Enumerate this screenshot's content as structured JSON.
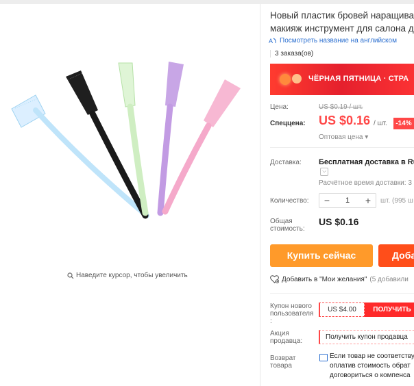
{
  "gallery": {
    "zoom_hint": "Наведите курсор, чтобы увеличить"
  },
  "product": {
    "title_line1": "Новый пластик бровей наращивание",
    "title_line2": "макияж инструмент для салона дом",
    "translate_link": "Посмотреть название на английском",
    "orders": "3 заказа(ов)"
  },
  "banner": {
    "text": "ЧЁРНАЯ ПЯТНИЦА · СТРА"
  },
  "price": {
    "label": "Цена:",
    "old": "US $0.19 / шт.",
    "special_label": "Спеццена:",
    "current": "US $0.16",
    "unit": "/ шт.",
    "discount": "-14%",
    "wholesale": "Оптовая цена ▾"
  },
  "shipping": {
    "label": "Доставка:",
    "method": "Бесплатная доставка в Russ",
    "dropdown_icon": "chevron-down-icon",
    "time": "Расчётное время доставки: 3"
  },
  "quantity": {
    "label": "Количество:",
    "minus": "−",
    "value": "1",
    "plus": "+",
    "stock": "шт. (995 ш"
  },
  "total": {
    "label_line1": "Общая",
    "label_line2": "стоимость:",
    "value": "US $0.16"
  },
  "actions": {
    "buy_now": "Купить сейчас",
    "add_to_cart": "Доба",
    "wishlist": "Добавить в \"Мои желания\"",
    "wishlist_count": "(5 добавили"
  },
  "coupons": {
    "new_user_label_1": "Купон нового",
    "new_user_label_2": "пользователя",
    "new_user_label_3": ":",
    "new_user_amount": "US $4.00",
    "get_button": "ПОЛУЧИТЬ",
    "seller_label_1": "Акция",
    "seller_label_2": "продавца:",
    "seller_coupon": "Получить купон продавца"
  },
  "returns": {
    "label_line1": "Возврат",
    "label_line2": "товара",
    "line1": "Если товар не соответству",
    "line2": "оплатив стоимость обрат",
    "line3": "договориться о компенса"
  },
  "colors": {
    "price_red": "#ff4747",
    "buy_orange": "#ff9a2a",
    "cart_orange": "#ff4e1a",
    "link_blue": "#2b6fd0"
  }
}
